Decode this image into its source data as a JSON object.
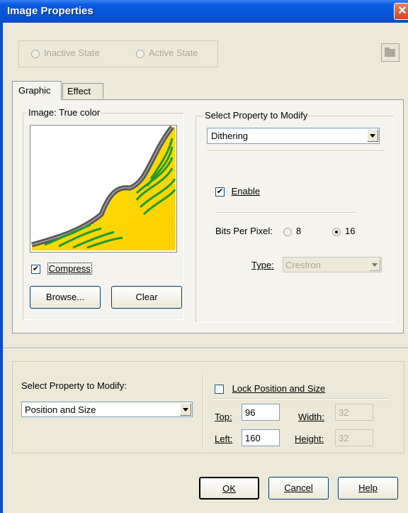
{
  "window": {
    "title": "Image Properties"
  },
  "state": {
    "inactive_label": "Inactive State",
    "active_label": "Active State"
  },
  "tabs": [
    {
      "label": "Graphic"
    },
    {
      "label": "Effect"
    }
  ],
  "image_group": {
    "title": "Image: True color",
    "compress_label": "Compress",
    "compress_checked": true,
    "browse_label": "Browse...",
    "clear_label": "Clear"
  },
  "property_group": {
    "title": "Select Property to Modify",
    "selected": "Dithering",
    "enable_label": "Enable",
    "enable_checked": true,
    "bits_label": "Bits Per Pixel:",
    "bits_options": [
      "8",
      "16"
    ],
    "bits_selected": "16",
    "type_label": "Type:",
    "type_value": "Crestron"
  },
  "position_group": {
    "title": "Select Property to Modify:",
    "selected": "Position and Size",
    "lock_label": "Lock Position and Size",
    "lock_checked": false,
    "top_label": "Top:",
    "top_value": "96",
    "left_label": "Left:",
    "left_value": "160",
    "width_label": "Width:",
    "width_value": "32",
    "height_label": "Height:",
    "height_value": "32"
  },
  "buttons": {
    "ok": "OK",
    "cancel": "Cancel",
    "help": "Help"
  }
}
